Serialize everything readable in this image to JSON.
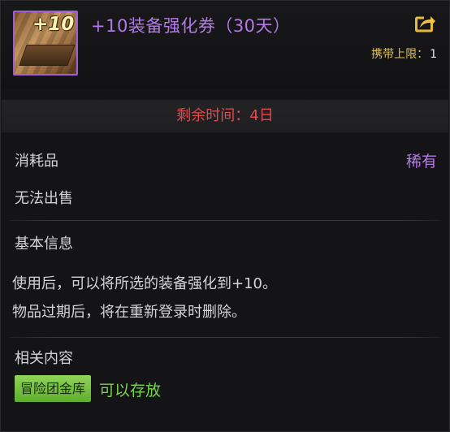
{
  "item": {
    "icon_text": "+10",
    "name": "+10装备强化券（30天）",
    "carry_limit_label": "携带上限：",
    "carry_limit_value": "1"
  },
  "remaining_time": "剩余时间：4日",
  "category": {
    "type": "消耗品",
    "rarity": "稀有",
    "sell": "无法出售"
  },
  "basic_info": {
    "title": "基本信息",
    "lines": [
      "使用后，可以将所选的装备强化到+10。",
      "物品过期后，将在重新登录时删除。"
    ]
  },
  "related": {
    "title": "相关内容",
    "storage_label": "冒险团金库",
    "storage_note": "可以存放"
  },
  "colors": {
    "rarity": "#b27ae4",
    "time": "#e2494d",
    "carry_label": "#e0c25a",
    "storable": "#78d44a"
  },
  "icons": {
    "share": "share-arrow-icon"
  }
}
